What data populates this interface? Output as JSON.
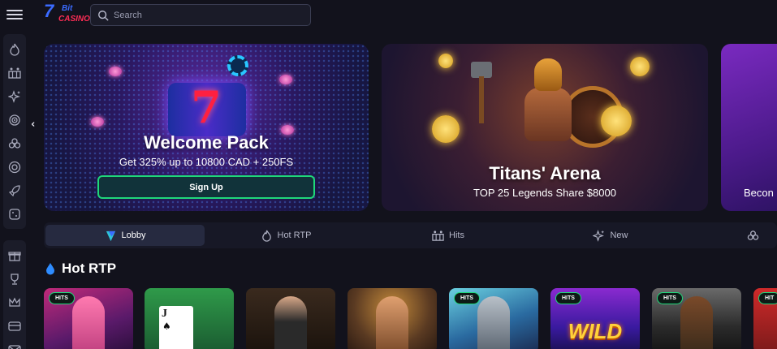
{
  "search": {
    "placeholder": "Search"
  },
  "logo": {
    "number": "7",
    "bit": "Bit",
    "casino": "CASINO"
  },
  "banners": [
    {
      "title": "Welcome Pack",
      "subtitle": "Get 325% up to 10800 CAD + 250FS",
      "button": "Sign Up"
    },
    {
      "title": "Titans' Arena",
      "subtitle": "TOP 25 Legends Share $8000"
    },
    {
      "subtitle": "Becon"
    }
  ],
  "tabs": [
    {
      "label": "Lobby",
      "icon": "lobby-icon",
      "active": true
    },
    {
      "label": "Hot RTP",
      "icon": "flame-icon"
    },
    {
      "label": "Hits",
      "icon": "hits-icon"
    },
    {
      "label": "New",
      "icon": "sparkle-icon"
    }
  ],
  "section": {
    "title": "Hot RTP"
  },
  "games": [
    {
      "badge": "HITS"
    },
    {
      "card_rank": "J",
      "card_suit": "♠"
    },
    {},
    {},
    {
      "badge": "HITS"
    },
    {
      "badge": "HITS",
      "overlay": "WILD"
    },
    {
      "badge": "HITS"
    },
    {
      "badge": "HIT"
    }
  ],
  "colors": {
    "accent": "#1fd87a",
    "background": "#12121c",
    "panel": "#1b1c29",
    "brand_blue": "#3b6bff",
    "brand_red": "#ff2d55"
  }
}
